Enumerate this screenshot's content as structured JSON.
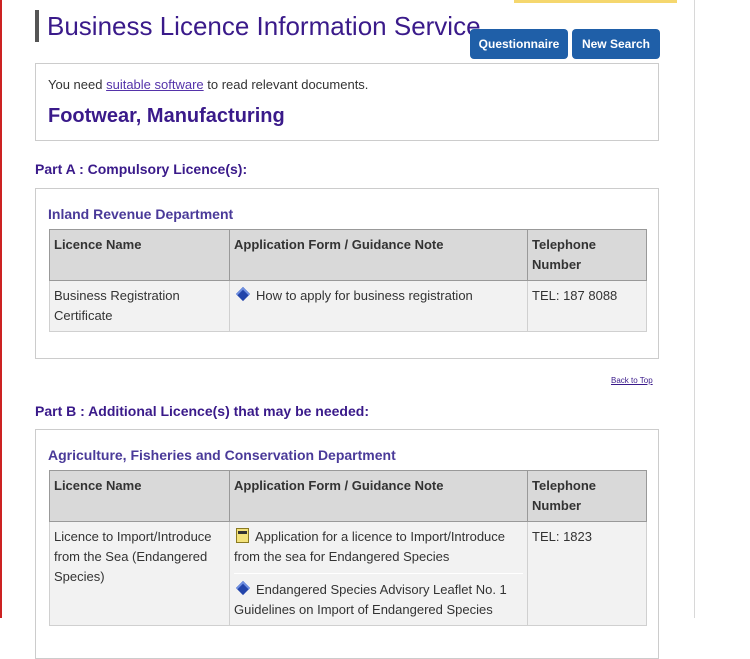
{
  "header": {
    "title": "Business Licence Information Service",
    "buttons": {
      "questionnaire": "Questionnaire",
      "new_search": "New Search"
    }
  },
  "notice": {
    "prefix": "You need ",
    "link": "suitable software",
    "suffix": " to read relevant documents."
  },
  "category": "Footwear, Manufacturing",
  "table_headers": [
    "Licence Name",
    "Application Form / Guidance Note",
    "Telephone Number"
  ],
  "part_a": {
    "heading": "Part A : Compulsory Licence(s):",
    "department": "Inland Revenue Department",
    "rows": [
      {
        "licence": "Business Registration Certificate",
        "forms": [
          {
            "icon": "diamond-icon",
            "text": "How to apply for business registration"
          }
        ],
        "telephone": "TEL: 187 8088"
      }
    ]
  },
  "back_to_top": "Back to Top",
  "part_b": {
    "heading": "Part B : Additional Licence(s) that may be needed:",
    "department": "Agriculture, Fisheries and Conservation Department",
    "rows": [
      {
        "licence": "Licence to Import/Introduce from the Sea (Endangered Species)",
        "forms": [
          {
            "icon": "html-document-icon",
            "text": "Application for a licence to Import/Introduce from the sea for Endangered Species"
          },
          {
            "icon": "diamond-icon",
            "text": "Endangered Species Advisory Leaflet No. 1 Guidelines on Import of Endangered Species"
          }
        ],
        "telephone": "TEL: 1823"
      }
    ]
  },
  "colors": {
    "title": "#3a1a8a",
    "button": "#1f5fa8",
    "header_cell": "#d9d9d9",
    "body_cell": "#f2f2f2",
    "left_rule": "#cc2222"
  }
}
